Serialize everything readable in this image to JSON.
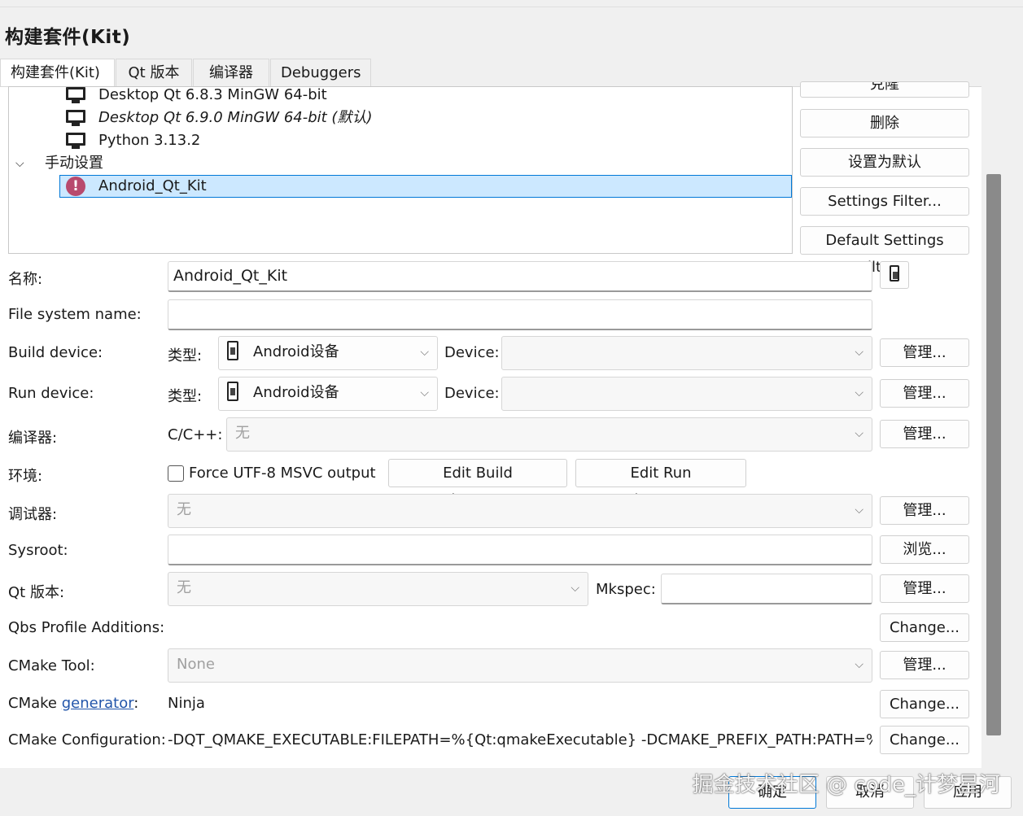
{
  "window": {
    "title": "构建套件(Kit)"
  },
  "tabs": [
    {
      "label": "构建套件(Kit)",
      "active": true
    },
    {
      "label": "Qt 版本",
      "active": false
    },
    {
      "label": "编译器",
      "active": false
    },
    {
      "label": "Debuggers",
      "active": false
    }
  ],
  "tree": {
    "items": [
      {
        "label": "Desktop Qt 6.8.3 MinGW 64-bit",
        "icon": "monitor-icon"
      },
      {
        "label": "Desktop Qt 6.9.0 MinGW 64-bit (默认)",
        "icon": "monitor-icon",
        "italic": true
      },
      {
        "label": "Python 3.13.2",
        "icon": "monitor-icon"
      }
    ],
    "group": {
      "label": "手动设置",
      "expanded": true
    },
    "group_items": [
      {
        "label": "Android_Qt_Kit",
        "icon": "warning-icon",
        "selected": true
      }
    ]
  },
  "side_buttons": {
    "add_partial": "克隆",
    "delete": "删除",
    "set_default": "设置为默认",
    "settings_filter": "Settings Filter...",
    "default_settings_filter": "Default Settings Filter..."
  },
  "form": {
    "name_label": "名称:",
    "name_value": "Android_Qt_Kit",
    "fs_name_label": "File system name:",
    "fs_name_value": "",
    "build_device_label": "Build device:",
    "type_label": "类型:",
    "build_device_type": "Android设备",
    "device_label": "Device:",
    "build_device_value": "",
    "run_device_label": "Run device:",
    "run_device_type": "Android设备",
    "run_device_value": "",
    "compiler_label": "编译器:",
    "cpp_label": "C/C++:",
    "compiler_value": "无",
    "env_label": "环境:",
    "force_utf8_label": "Force UTF-8 MSVC output",
    "force_utf8_checked": false,
    "edit_build_env": "Edit Build Environment...",
    "edit_run_env": "Edit Run Environment...",
    "debugger_label": "调试器:",
    "debugger_value": "无",
    "sysroot_label": "Sysroot:",
    "sysroot_value": "",
    "qt_version_label": "Qt 版本:",
    "qt_version_value": "无",
    "mkspec_label": "Mkspec:",
    "mkspec_value": "",
    "qbs_label": "Qbs Profile Additions:",
    "cmake_tool_label": "CMake Tool:",
    "cmake_tool_value": "None",
    "cmake_gen_prefix": "CMake ",
    "cmake_gen_link": "generator",
    "cmake_gen_suffix": ":",
    "cmake_gen_value": "Ninja",
    "cmake_config_label": "CMake Configuration:",
    "cmake_config_value": "-DQT_QMAKE_EXECUTABLE:FILEPATH=%{Qt:qmakeExecutable} -DCMAKE_PREFIX_PATH:PATH=%{Q..."
  },
  "buttons": {
    "manage": "管理...",
    "browse": "浏览...",
    "change": "Change..."
  },
  "footer": {
    "ok": "确定",
    "cancel": "取消",
    "apply": "应用"
  },
  "watermark": "掘金技术社区 @ code_计梦星河"
}
